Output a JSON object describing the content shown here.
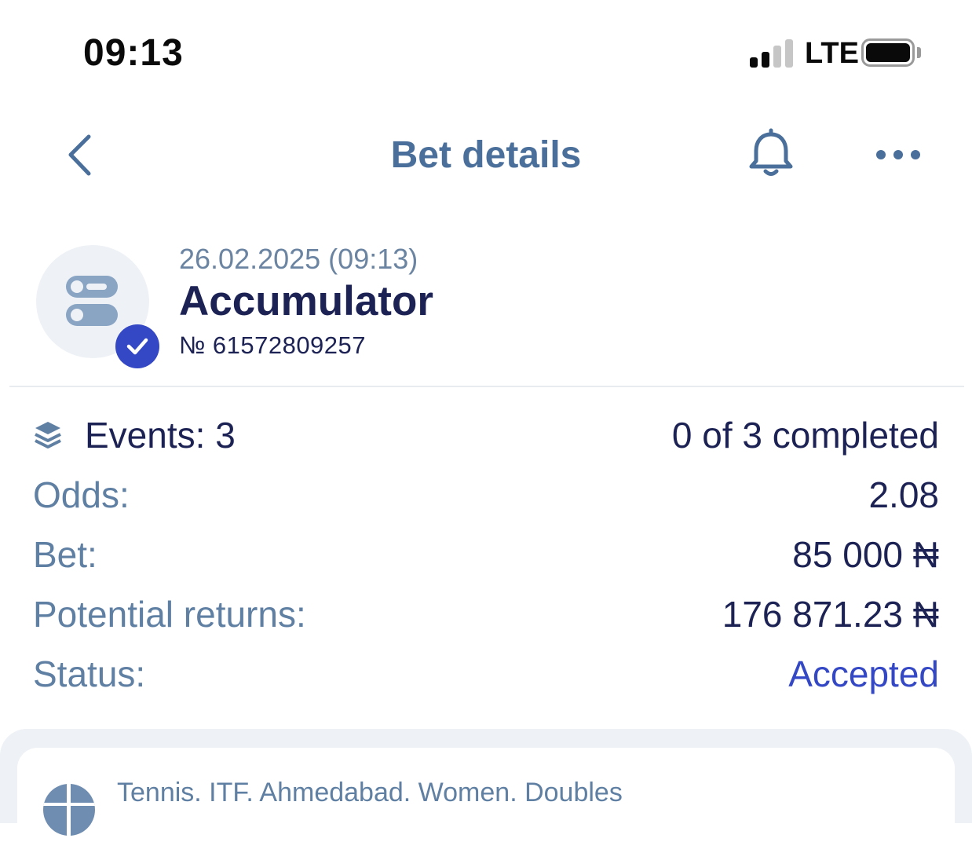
{
  "status_bar": {
    "time": "09:13",
    "network": "LTE",
    "signal_bars_active": 2,
    "signal_bars_total": 4,
    "battery_level": 1.0
  },
  "header": {
    "title": "Bet details",
    "back_icon": "chevron-left-icon",
    "bell_icon": "bell-icon",
    "more_icon": "more-horizontal-icon"
  },
  "bet": {
    "datetime": "26.02.2025 (09:13)",
    "type": "Accumulator",
    "number": "№ 61572809257",
    "type_icon": "accumulator-icon",
    "verified_icon": "check-icon"
  },
  "details": {
    "events_label": "Events: 3",
    "events_icon": "layers-icon",
    "completed": "0 of 3 completed",
    "odds_label": "Odds:",
    "odds_value": "2.08",
    "bet_label": "Bet:",
    "bet_value": "85 000 ₦",
    "returns_label": "Potential returns:",
    "returns_value": "176 871.23 ₦",
    "status_label": "Status:",
    "status_value": "Accepted"
  },
  "event": {
    "league": "Tennis. ITF. Ahmedabad. Women. Doubles",
    "sport_icon": "tennis-ball-icon"
  },
  "colors": {
    "title_blue": "#4a6f9a",
    "label_blue": "#5f7fa3",
    "dark_navy": "#1c2254",
    "accent": "#3448c5",
    "card_bg": "#eef1f5"
  }
}
